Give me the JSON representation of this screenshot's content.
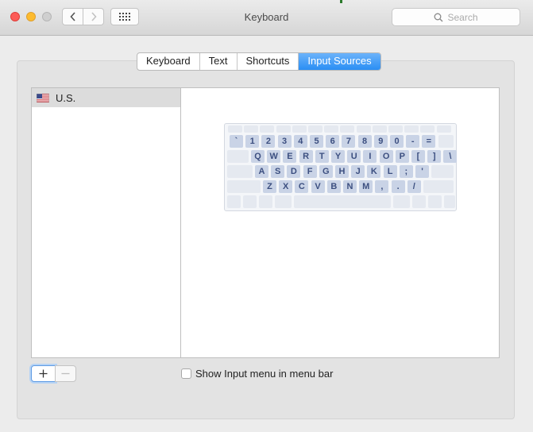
{
  "window": {
    "title": "Keyboard"
  },
  "search": {
    "placeholder": "Search"
  },
  "tabs": [
    {
      "label": "Keyboard"
    },
    {
      "label": "Text"
    },
    {
      "label": "Shortcuts"
    },
    {
      "label": "Input Sources",
      "active": true
    }
  ],
  "sources": {
    "items": [
      {
        "label": "U.S.",
        "icon": "us-flag-icon"
      }
    ]
  },
  "keyboard": {
    "rows": [
      [
        "`",
        "1",
        "2",
        "3",
        "4",
        "5",
        "6",
        "7",
        "8",
        "9",
        "0",
        "-",
        "="
      ],
      [
        "Q",
        "W",
        "E",
        "R",
        "T",
        "Y",
        "U",
        "I",
        "O",
        "P",
        "[",
        "]",
        "\\"
      ],
      [
        "A",
        "S",
        "D",
        "F",
        "G",
        "H",
        "J",
        "K",
        "L",
        ";",
        "'"
      ],
      [
        "Z",
        "X",
        "C",
        "V",
        "B",
        "N",
        "M",
        ",",
        ".",
        "/"
      ]
    ]
  },
  "buttons": {
    "add": "+",
    "remove": "−"
  },
  "options": {
    "show_input_menu": {
      "label": "Show Input menu in menu bar",
      "checked": false
    }
  },
  "colors": {
    "accent": "#2a8ef4",
    "key_label": "#3c4f80"
  }
}
